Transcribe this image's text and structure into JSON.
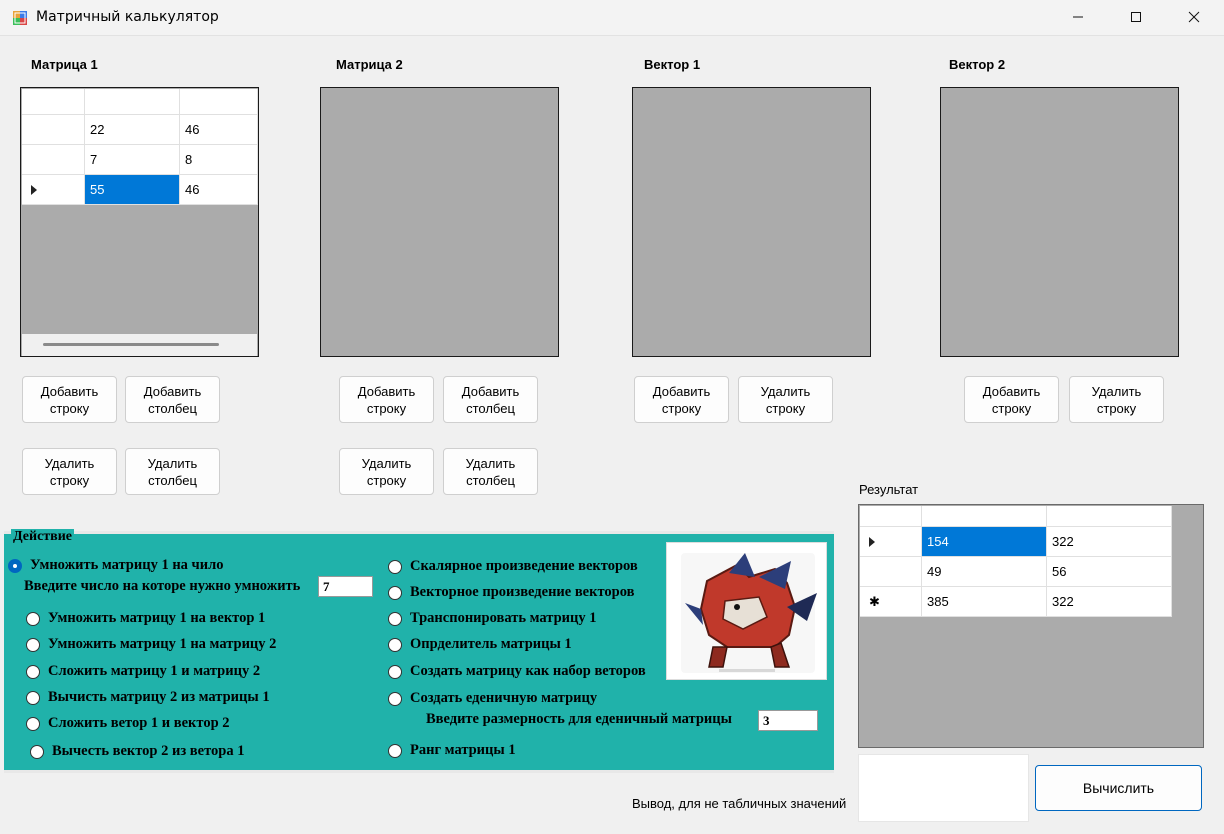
{
  "window": {
    "title": "Матричный калькулятор",
    "icon": "app-icon",
    "controls": [
      "minimize-icon",
      "maximize-icon",
      "close-icon"
    ]
  },
  "sections": {
    "matrix1": "Матрица 1",
    "matrix2": "Матрица 2",
    "vector1": "Вектор 1",
    "vector2": "Вектор 2"
  },
  "matrix1_grid": {
    "rows": [
      [
        "22",
        "46"
      ],
      [
        "7",
        "8"
      ],
      [
        "55",
        "46"
      ]
    ],
    "selected": "55"
  },
  "buttons": {
    "add_row": "Добавить\nстроку",
    "add_col": "Добавить\nстолбец",
    "del_row": "Удалить\nстроку",
    "del_col": "Удалить\nстолбец",
    "calculate": "Вычислить"
  },
  "action": {
    "legend": "Действие",
    "options_left": [
      "Умножить матрицу 1 на чило",
      "Умножить матрицу 1 на вектор 1",
      "Умножить матрицу 1 на матрицу 2",
      "Сложить матрицу 1 и матрицу 2",
      "Вычисть матрицу 2 из матрицы 1",
      "Сложить ветор 1 и вектор 2",
      "Вычесть вектор 2 из ветора 1"
    ],
    "options_right": [
      "Скалярное произведение векторов",
      "Векторное произведение векторов",
      "Транспонировать матрицу 1",
      "Опрделитель матрицы 1",
      "Создать матрицу как набор веторов",
      "Создать еденичную матрицу",
      "Ранг матрицы 1"
    ],
    "selected": "Умножить матрицу 1 на чило",
    "multiply_prompt": "Введите число на которе нужно умножить",
    "multiply_value": "7",
    "identity_prompt": "Введите размерность для еденичный матрицы",
    "identity_value": "3"
  },
  "result": {
    "label": "Результат",
    "rows": [
      [
        "154",
        "322"
      ],
      [
        "49",
        "56"
      ],
      [
        "385",
        "322"
      ]
    ],
    "selected": "154"
  },
  "output": {
    "label": "Вывод, для не табличных значений"
  },
  "colors": {
    "action_bg": "#20b2aa",
    "selection": "#0078d7",
    "grid_bg": "#ababab"
  }
}
